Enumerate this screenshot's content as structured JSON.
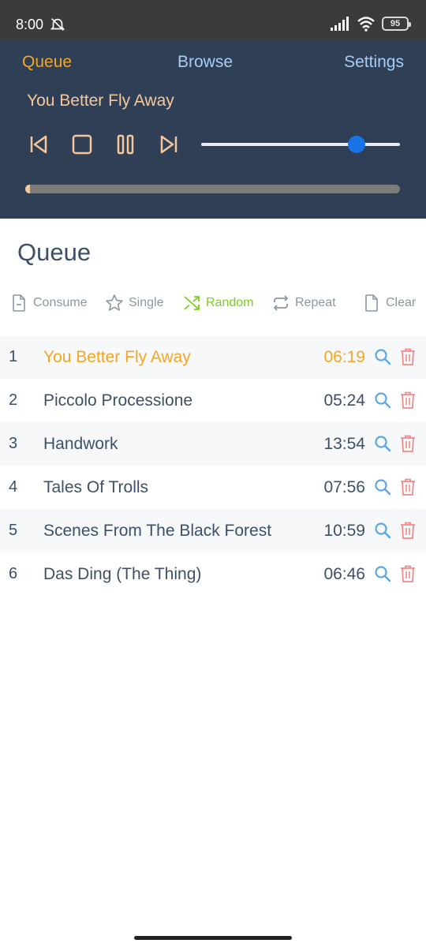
{
  "status_bar": {
    "time": "8:00",
    "battery": "95",
    "icons": [
      "mute-alarm-icon",
      "signal-icon",
      "wifi-icon",
      "battery-icon"
    ]
  },
  "nav": {
    "tabs": [
      {
        "label": "Queue",
        "active": true
      },
      {
        "label": "Browse",
        "active": false
      },
      {
        "label": "Settings",
        "active": false
      }
    ]
  },
  "player": {
    "now_playing": "You Better Fly Away",
    "controls": [
      "previous-icon",
      "stop-icon",
      "pause-icon",
      "next-icon"
    ],
    "volume_fraction": 0.78,
    "progress_fraction": 0.01
  },
  "queue": {
    "heading": "Queue",
    "toolbar": {
      "consume": "Consume",
      "single": "Single",
      "random": "Random",
      "repeat": "Repeat",
      "clear": "Clear"
    },
    "tracks": [
      {
        "num": "1",
        "title": "You Better Fly Away",
        "duration": "06:19",
        "playing": true
      },
      {
        "num": "2",
        "title": "Piccolo Processione",
        "duration": "05:24",
        "playing": false
      },
      {
        "num": "3",
        "title": "Handwork",
        "duration": "13:54",
        "playing": false
      },
      {
        "num": "4",
        "title": "Tales Of Trolls",
        "duration": "07:56",
        "playing": false
      },
      {
        "num": "5",
        "title": "Scenes From The Black Forest",
        "duration": "10:59",
        "playing": false
      },
      {
        "num": "6",
        "title": "Das Ding (The Thing)",
        "duration": "06:46",
        "playing": false
      }
    ]
  },
  "colors": {
    "header_bg": "#2f3f56",
    "accent_orange": "#f5a623",
    "random_green": "#7ccf1e",
    "search_blue": "#5aa7e8",
    "delete_red": "#f08a8a",
    "volume_blue": "#1a73e8"
  }
}
